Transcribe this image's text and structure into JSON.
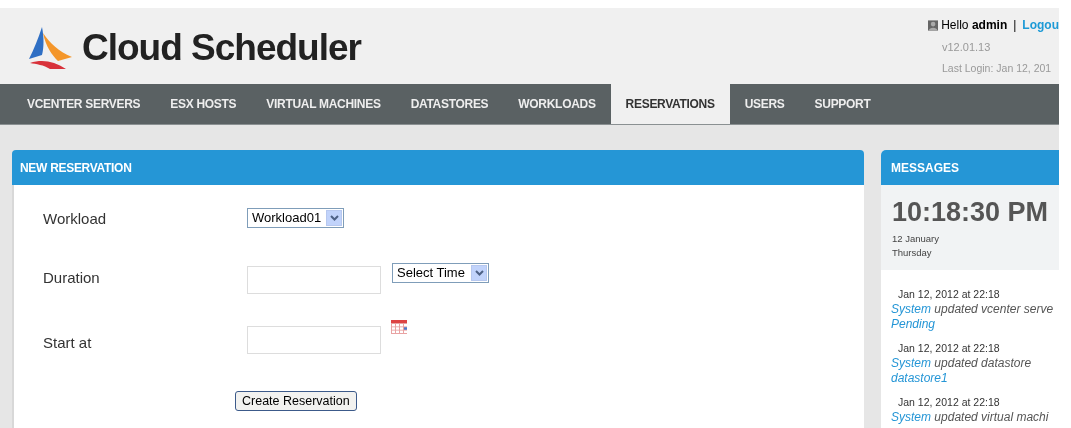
{
  "header": {
    "logo_text": "Cloud Scheduler",
    "greeting": "Hello",
    "user": "admin",
    "separator": "|",
    "logout": "Logou",
    "version": "v12.01.13",
    "last_login": "Last Login: Jan 12, 201"
  },
  "nav": [
    {
      "label": "VCENTER SERVERS",
      "selected": false
    },
    {
      "label": "ESX HOSTS",
      "selected": false
    },
    {
      "label": "VIRTUAL MACHINES",
      "selected": false
    },
    {
      "label": "DATASTORES",
      "selected": false
    },
    {
      "label": "WORKLOADS",
      "selected": false
    },
    {
      "label": "RESERVATIONS",
      "selected": true
    },
    {
      "label": "USERS",
      "selected": false
    },
    {
      "label": "SUPPORT",
      "selected": false
    }
  ],
  "form": {
    "title": "NEW RESERVATION",
    "fields": [
      {
        "kind": "select",
        "label": "Workload",
        "value": "Workload01"
      },
      {
        "kind": "text_select",
        "label": "Duration",
        "select_value": "Select Time"
      },
      {
        "kind": "date",
        "label": "Start at"
      }
    ],
    "submit": "Create Reservation"
  },
  "messages": {
    "title": "MESSAGES",
    "time": "10:18:30 PM",
    "date": "12 January",
    "weekday": "Thursday",
    "items": [
      {
        "timestamp": "Jan 12, 2012 at 22:18",
        "actor": "System",
        "action": "updated vcenter serve",
        "object": "Pending"
      },
      {
        "timestamp": "Jan 12, 2012 at 22:18",
        "actor": "System",
        "action": "updated datastore",
        "object": "datastore1"
      },
      {
        "timestamp": "Jan 12, 2012 at 22:18",
        "actor": "System",
        "action": "updated virtual machi"
      }
    ]
  }
}
